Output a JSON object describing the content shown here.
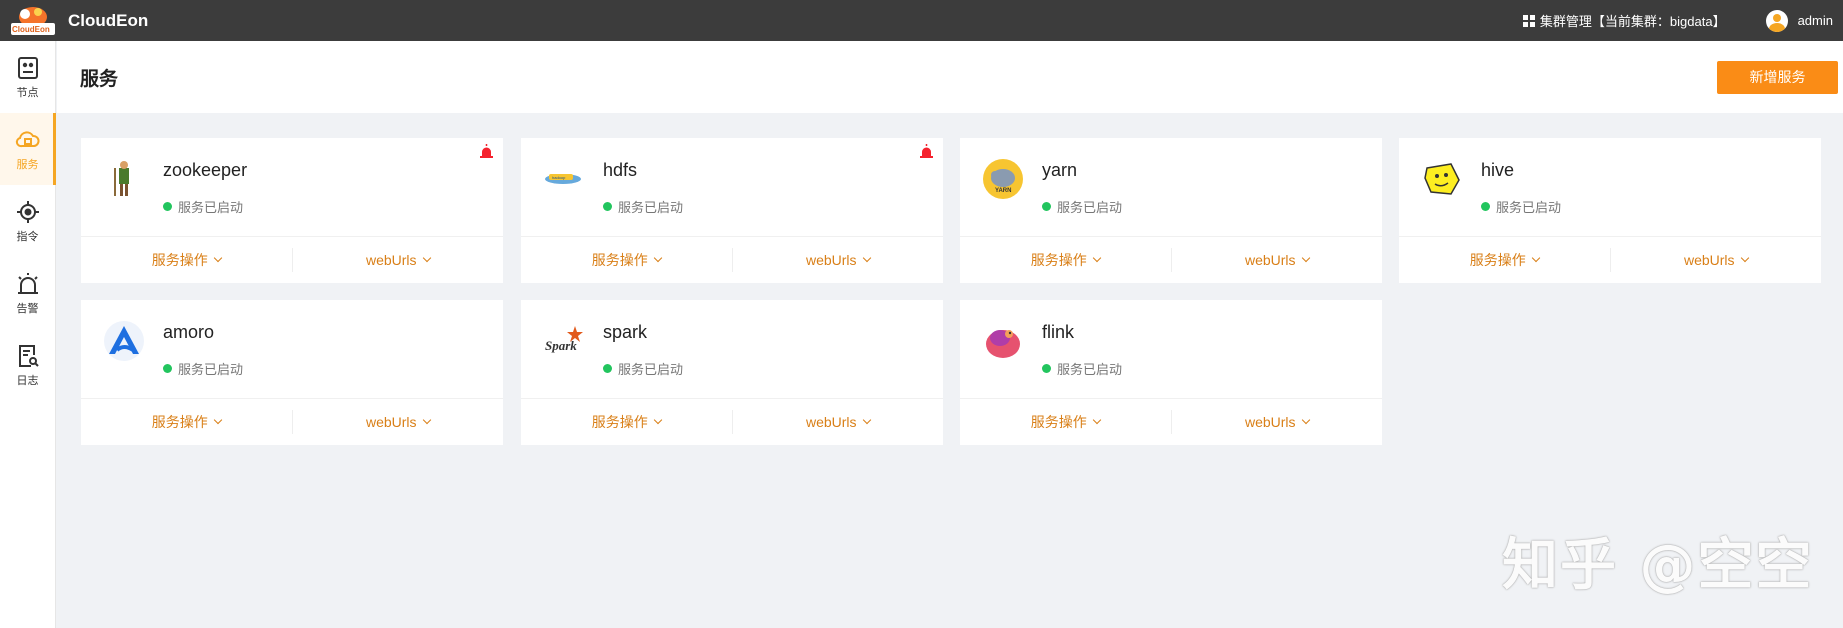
{
  "app": {
    "brand": "CloudEon",
    "logo_text": "CloudEon"
  },
  "topbar": {
    "cluster_label": "集群管理【当前集群：bigdata】",
    "user": "admin"
  },
  "sidebar": {
    "items": [
      {
        "label": "节点",
        "icon": "node-icon"
      },
      {
        "label": "服务",
        "icon": "cloud-service-icon"
      },
      {
        "label": "指令",
        "icon": "target-icon"
      },
      {
        "label": "告警",
        "icon": "alarm-icon"
      },
      {
        "label": "日志",
        "icon": "log-icon"
      }
    ]
  },
  "header": {
    "title": "服务",
    "add_button": "新增服务"
  },
  "services": [
    {
      "name": "zookeeper",
      "status": "服务已启动",
      "ops": "服务操作",
      "web": "webUrls",
      "alarm": true
    },
    {
      "name": "hdfs",
      "status": "服务已启动",
      "ops": "服务操作",
      "web": "webUrls",
      "alarm": true
    },
    {
      "name": "yarn",
      "status": "服务已启动",
      "ops": "服务操作",
      "web": "webUrls",
      "alarm": false
    },
    {
      "name": "hive",
      "status": "服务已启动",
      "ops": "服务操作",
      "web": "webUrls",
      "alarm": false
    },
    {
      "name": "amoro",
      "status": "服务已启动",
      "ops": "服务操作",
      "web": "webUrls",
      "alarm": false
    },
    {
      "name": "spark",
      "status": "服务已启动",
      "ops": "服务操作",
      "web": "webUrls",
      "alarm": false
    },
    {
      "name": "flink",
      "status": "服务已启动",
      "ops": "服务操作",
      "web": "webUrls",
      "alarm": false
    }
  ],
  "colors": {
    "accent": "#fa8c16",
    "status_ok": "#22c55e",
    "alarm": "#f5222d",
    "topbar": "#3c3c3c"
  },
  "watermark": "知乎 @空空"
}
